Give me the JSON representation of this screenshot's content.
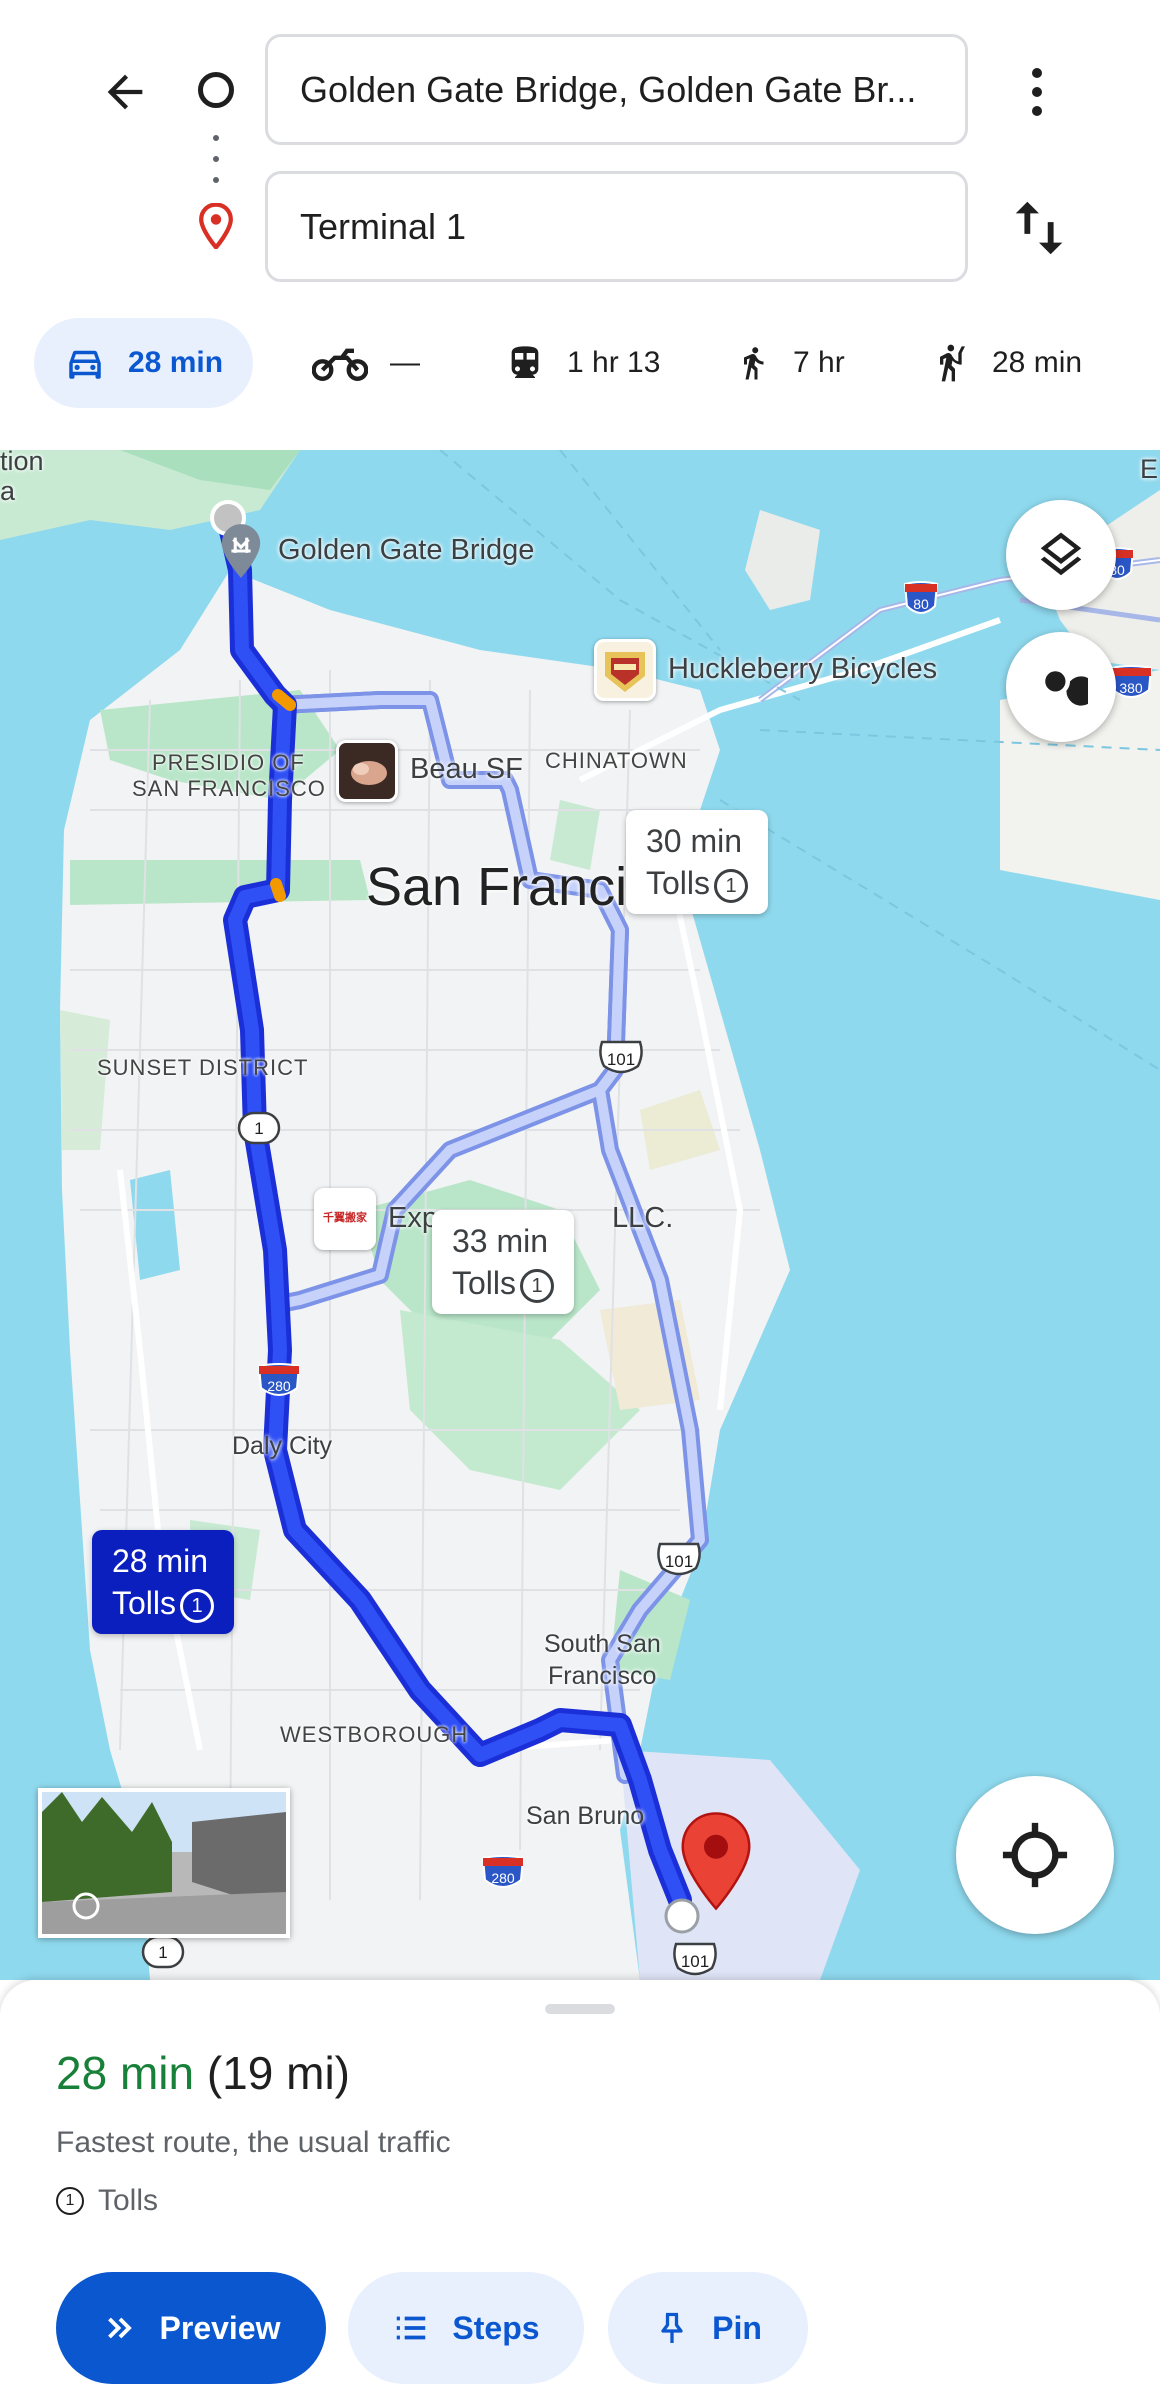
{
  "header": {
    "origin_value": "Golden Gate Bridge, Golden Gate Br...",
    "destination_value": "Terminal 1",
    "modes": [
      {
        "icon": "car-icon",
        "label": "28 min",
        "active": true
      },
      {
        "icon": "motorcycle-icon",
        "label": "—",
        "active": false
      },
      {
        "icon": "transit-icon",
        "label": "1 hr 13",
        "active": false
      },
      {
        "icon": "walk-icon",
        "label": "7 hr",
        "active": false
      },
      {
        "icon": "ride-hail-icon",
        "label": "28 min",
        "active": false
      }
    ]
  },
  "map": {
    "labels": {
      "top_left_partial_1": "tion",
      "top_left_partial_2": "a",
      "top_right_partial": "E",
      "golden_gate": "Golden Gate Bridge",
      "huckleberry": "Huckleberry Bicycles",
      "presidio_1": "PRESIDIO OF",
      "presidio_2": "SAN FRANCISCO",
      "beau": "Beau SF",
      "chinatown": "CHINATOWN",
      "city": "San Franci",
      "sunset": "SUNSET DISTRICT",
      "exp_left": "Exp",
      "exp_right": "LLC.",
      "daly_city": "Daly City",
      "south_sf_1": "South San",
      "south_sf_2": "Francisco",
      "westborough": "WESTBOROUGH",
      "san_bruno": "San Bruno",
      "thumb_text": "千翼搬家"
    },
    "shields": {
      "i80": "80",
      "i80_right": "80",
      "i380": "380",
      "us101_a": "101",
      "us101_b": "101",
      "us101_c": "101",
      "ca1_a": "1",
      "ca1_b": "1",
      "i280_a": "280",
      "i280_b": "280"
    },
    "callouts": [
      {
        "time": "30 min",
        "tolls": "Tolls"
      },
      {
        "time": "33 min",
        "tolls": "Tolls"
      },
      {
        "time": "28 min",
        "tolls": "Tolls",
        "active": true
      }
    ]
  },
  "sheet": {
    "time": "28 min",
    "distance": "(19 mi)",
    "description": "Fastest route, the usual traffic",
    "tolls": "Tolls",
    "buttons": {
      "preview": "Preview",
      "steps": "Steps",
      "pin": "Pin"
    }
  },
  "colors": {
    "accent": "#0b57d0",
    "route_primary": "#1a3fe6",
    "route_alt": "#a6b8f5",
    "water": "#8fd9ee",
    "land": "#f1f3f4",
    "park": "#b9e6c9",
    "time_green": "#188038"
  }
}
